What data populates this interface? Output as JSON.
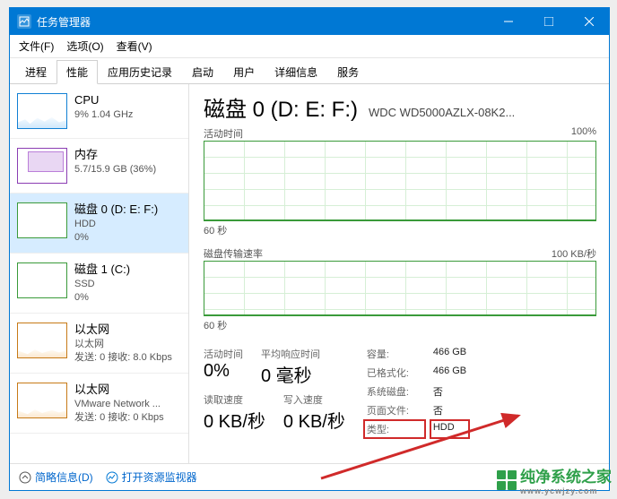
{
  "window": {
    "title": "任务管理器"
  },
  "menus": {
    "file": "文件(F)",
    "options": "选项(O)",
    "view": "查看(V)"
  },
  "tabs": [
    "进程",
    "性能",
    "应用历史记录",
    "启动",
    "用户",
    "详细信息",
    "服务"
  ],
  "active_tab": 1,
  "sidebar": [
    {
      "name": "CPU",
      "sub": "9% 1.04 GHz",
      "kind": "cpu"
    },
    {
      "name": "内存",
      "sub": "5.7/15.9 GB (36%)",
      "kind": "mem"
    },
    {
      "name": "磁盘 0 (D: E: F:)",
      "sub": "HDD",
      "sub2": "0%",
      "kind": "disk",
      "selected": true
    },
    {
      "name": "磁盘 1 (C:)",
      "sub": "SSD",
      "sub2": "0%",
      "kind": "disk"
    },
    {
      "name": "以太网",
      "sub": "以太网",
      "sub2": "发送: 0 接收: 8.0 Kbps",
      "kind": "eth"
    },
    {
      "name": "以太网",
      "sub": "VMware Network ...",
      "sub2": "发送: 0 接收: 0 Kbps",
      "kind": "eth"
    }
  ],
  "main": {
    "title": "磁盘 0 (D: E: F:)",
    "model": "WDC WD5000AZLX-08K2...",
    "chart1_label": "活动时间",
    "chart1_max": "100%",
    "chart1_axis": "60 秒",
    "chart2_label": "磁盘传输速率",
    "chart2_max": "100 KB/秒",
    "chart2_axis": "60 秒",
    "stats": {
      "active_lbl": "活动时间",
      "active_val": "0%",
      "resp_lbl": "平均响应时间",
      "resp_val": "0 毫秒",
      "read_lbl": "读取速度",
      "read_val": "0 KB/秒",
      "write_lbl": "写入速度",
      "write_val": "0 KB/秒"
    },
    "props": {
      "cap_k": "容量:",
      "cap_v": "466 GB",
      "fmt_k": "已格式化:",
      "fmt_v": "466 GB",
      "sys_k": "系统磁盘:",
      "sys_v": "否",
      "page_k": "页面文件:",
      "page_v": "否",
      "type_k": "类型:",
      "type_v": "HDD"
    }
  },
  "footer": {
    "brief": "简略信息(D)",
    "resmon": "打开资源监视器"
  },
  "watermark": {
    "brand": "纯净系统之家",
    "url": "www.ycwjzy.com"
  },
  "chart_data": {
    "type": "line",
    "series": [
      {
        "name": "活动时间",
        "unit": "%",
        "ylim": [
          0,
          100
        ],
        "xrange_seconds": 60,
        "values": [
          0,
          0,
          0,
          0,
          0,
          0,
          0,
          0,
          0,
          0,
          0,
          0
        ]
      },
      {
        "name": "磁盘传输速率",
        "unit": "KB/秒",
        "ylim": [
          0,
          100
        ],
        "xrange_seconds": 60,
        "values": [
          0,
          0,
          0,
          0,
          0,
          0,
          0,
          0,
          0,
          0,
          0,
          0
        ]
      }
    ]
  }
}
